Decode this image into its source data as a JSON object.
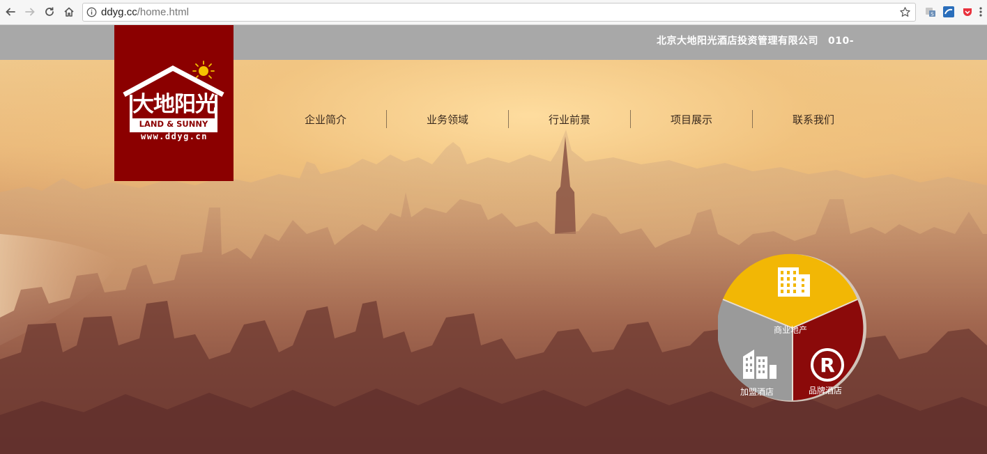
{
  "browser": {
    "url_host": "ddyg.cc",
    "url_path": "/home.html"
  },
  "header": {
    "company_name": "北京大地阳光酒店投资管理有限公司",
    "phone": "010-"
  },
  "logo": {
    "title": "大地阳光",
    "subtitle": "LAND & SUNNY",
    "website": "www.ddyg.cn"
  },
  "nav": {
    "items": [
      "企业简介",
      "业务领域",
      "行业前景",
      "项目展示",
      "联系我们"
    ]
  },
  "circle_menu": {
    "commercial": "商业地产",
    "franchise": "加盟酒店",
    "brand": "品牌酒店",
    "colors": {
      "commercial": "#f2b705",
      "franchise": "#9a9a9a",
      "brand": "#8b0a0a"
    }
  },
  "colors": {
    "logo_bg": "#8b0000",
    "topbar_bg": "#a8a8a8"
  }
}
